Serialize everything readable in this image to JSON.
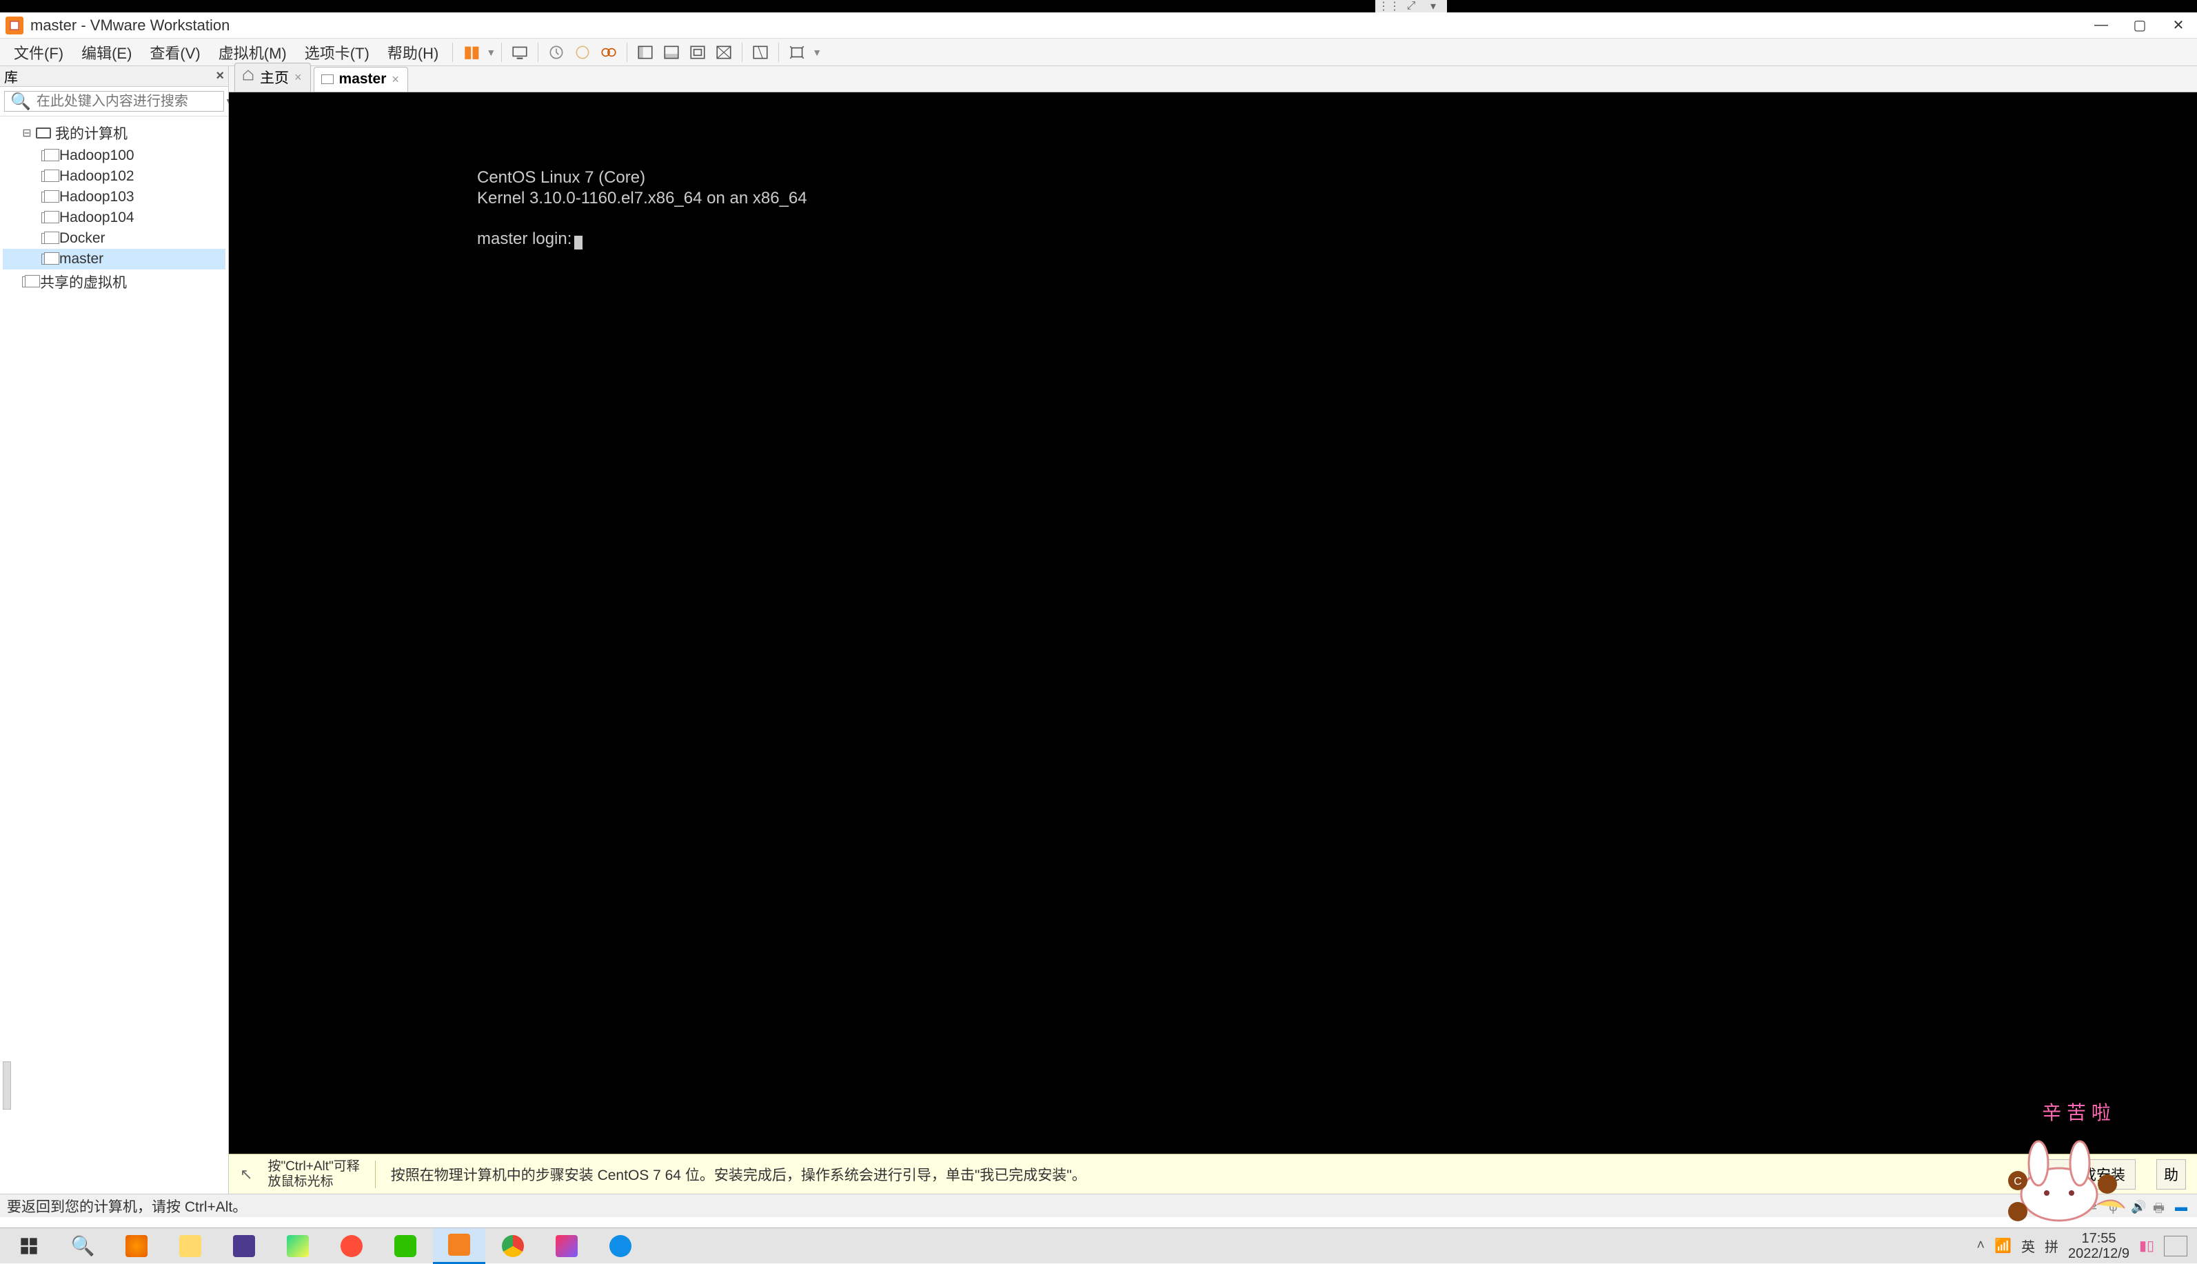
{
  "title_bar": {
    "title": "master - VMware Workstation"
  },
  "window_controls": {
    "min": "—",
    "max": "▢",
    "close": "✕"
  },
  "menu": {
    "file": "文件(F)",
    "edit": "编辑(E)",
    "view": "查看(V)",
    "vm": "虚拟机(M)",
    "tabs": "选项卡(T)",
    "help": "帮助(H)"
  },
  "sidebar": {
    "header": "库",
    "search_placeholder": "在此处键入内容进行搜索",
    "root": "我的计算机",
    "items": [
      "Hadoop100",
      "Hadoop102",
      "Hadoop103",
      "Hadoop104",
      "Docker",
      "master"
    ],
    "shared": "共享的虚拟机"
  },
  "tabs": {
    "home": "主页",
    "active": "master"
  },
  "console": {
    "line1": "CentOS Linux 7 (Core)",
    "line2": "Kernel 3.10.0-1160.el7.x86_64 on an x86_64",
    "blank": "",
    "line3": "master login:"
  },
  "hint": {
    "tip_line1": "按\"Ctrl+Alt\"可释",
    "tip_line2": "放鼠标光标",
    "msg": "按照在物理计算机中的步骤安装 CentOS 7 64 位。安装完成后，操作系统会进行引导，单击\"我已完成安装\"。",
    "done_btn": "我已完成安装",
    "help_btn": "助"
  },
  "status": {
    "msg": "要返回到您的计算机，请按 Ctrl+Alt。"
  },
  "taskbar": {
    "ime_lang": "英",
    "ime_mode": "拼",
    "time": "17:55",
    "date": "2022/12/9"
  },
  "mascot": {
    "text": "辛 苦 啦"
  }
}
